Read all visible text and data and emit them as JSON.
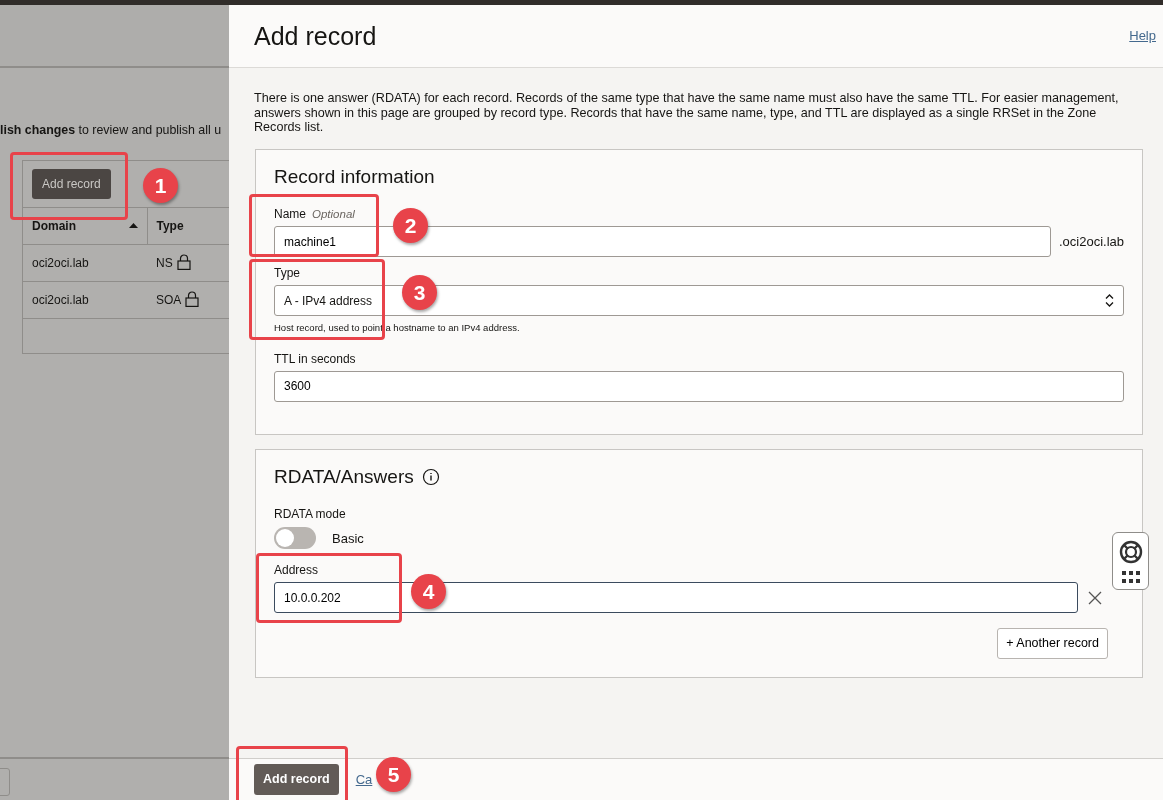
{
  "background_page": {
    "notice": "**lish changes** to review and publish all u",
    "add_button": "Add record",
    "columns": [
      {
        "label": "Domain",
        "sorted": true
      },
      {
        "label": "Type",
        "sorted": false
      }
    ],
    "rows": [
      {
        "domain": "oci2oci.lab",
        "type": "NS",
        "locked": true
      },
      {
        "domain": "oci2oci.lab",
        "type": "SOA",
        "locked": true
      }
    ]
  },
  "panel": {
    "title": "Add record",
    "help_link": "Help",
    "description": "There is one answer (RDATA) for each record. Records of the same type that have the same name must also have the same TTL. For easier management, answers shown in this page are grouped by record type. Records that have the same name, type, and TTL are displayed as a single RRSet in the Zone Records list.",
    "record_information": {
      "title": "Record information",
      "name_field": {
        "label": "Name",
        "optional_tag": "Optional",
        "value": "machine1",
        "suffix": ".oci2oci.lab"
      },
      "type_field": {
        "label": "Type",
        "value": "A - IPv4 address",
        "help": "Host record, used to point a hostname to an IPv4 address."
      },
      "ttl_field": {
        "label": "TTL in seconds",
        "value": "3600"
      }
    },
    "rdata": {
      "title": "RDATA/Answers",
      "mode_label": "RDATA mode",
      "toggle": {
        "on": false,
        "label": "Basic"
      },
      "address": {
        "label": "Address",
        "value": "10.0.0.202"
      },
      "another_button": "+ Another record"
    },
    "footer": {
      "submit": "Add record",
      "cancel": "Ca"
    }
  },
  "annotations": [
    {
      "number": "1"
    },
    {
      "number": "2"
    },
    {
      "number": "3"
    },
    {
      "number": "4"
    },
    {
      "number": "5"
    }
  ]
}
